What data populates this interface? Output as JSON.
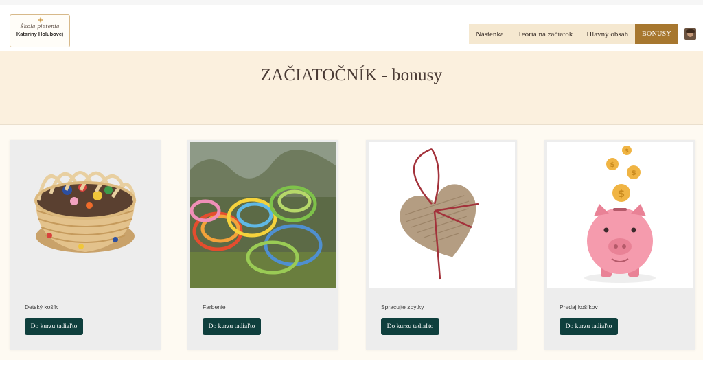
{
  "logo": {
    "script_line": "Škola pletenia",
    "name_line": "Katariny Holubovej"
  },
  "nav": {
    "items": [
      {
        "label": "Nástenka"
      },
      {
        "label": "Teória na začiatok"
      },
      {
        "label": "Hlavný obsah"
      },
      {
        "label": "BONUSY"
      }
    ]
  },
  "hero": {
    "title": "ZAČIATOČNÍK - bonusy"
  },
  "cards": [
    {
      "title": "Detský košík",
      "button": "Do kurzu tadiaľto",
      "image": "wicker-basket-image"
    },
    {
      "title": "Farbenie",
      "button": "Do kurzu tadiaľto",
      "image": "dyed-rattan-coils-image"
    },
    {
      "title": "Spracujte zbytky",
      "button": "Do kurzu tadiaľto",
      "image": "woven-heart-image"
    },
    {
      "title": "Predaj košíkov",
      "button": "Do kurzu tadiaľto",
      "image": "piggy-bank-coins-image"
    }
  ],
  "colors": {
    "nav_bg": "#f5e8d0",
    "nav_active": "#a7772f",
    "hero_bg": "#fbf0de",
    "button_bg": "#0f3f3d",
    "card_bg": "#ededed"
  }
}
